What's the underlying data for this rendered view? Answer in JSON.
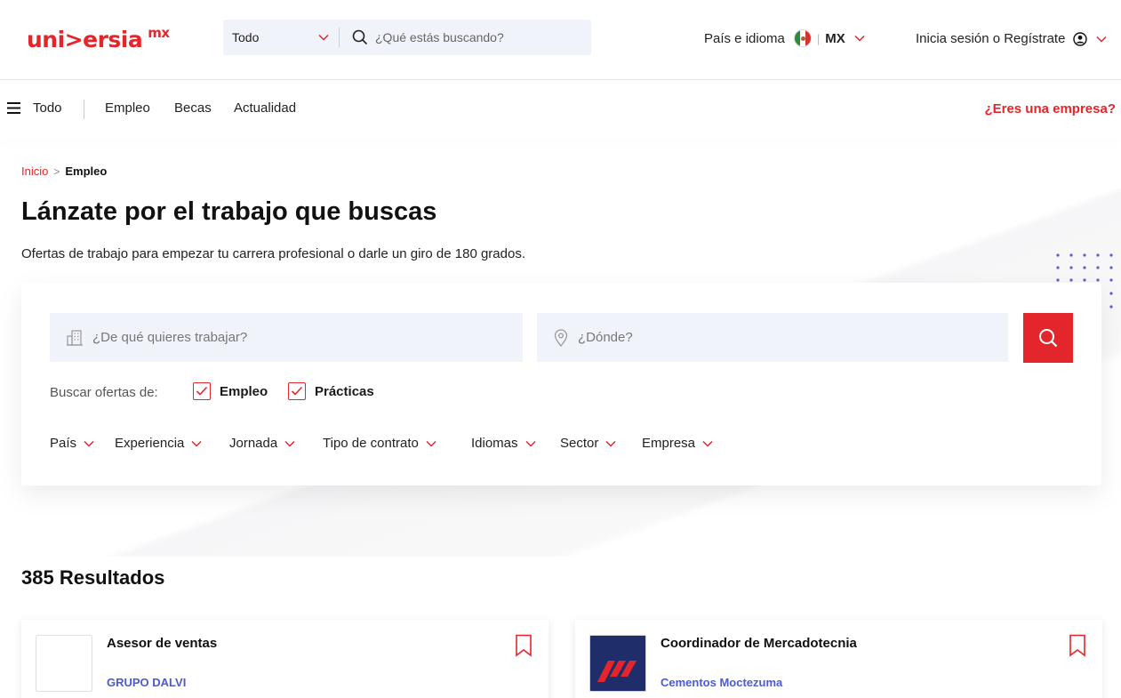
{
  "header": {
    "logo_text": "uni>ersia",
    "logo_suffix": "mx",
    "search_select": "Todo",
    "search_placeholder": "¿Qué estás buscando?",
    "country_label": "País e idioma",
    "country_sep": "|",
    "country_code": "MX",
    "login_label": "Inicia sesión o Regístrate"
  },
  "nav": {
    "menu_label": "Todo",
    "links": [
      "Empleo",
      "Becas",
      "Actualidad"
    ],
    "company_link": "¿Eres una empresa?"
  },
  "breadcrumb": {
    "home": "Inicio",
    "separator": ">",
    "current": "Empleo"
  },
  "hero": {
    "title": "Lánzate por el trabajo que buscas",
    "subtitle": "Ofertas de trabajo para empezar tu carrera profesional o darle un giro de 180 grados."
  },
  "search": {
    "what_placeholder": "¿De qué quieres trabajar?",
    "where_placeholder": "¿Dónde?",
    "filter_label": "Buscar ofertas de:",
    "checks": [
      {
        "label": "Empleo",
        "checked": true
      },
      {
        "label": "Prácticas",
        "checked": true
      }
    ],
    "dropdowns": [
      "País",
      "Experiencia",
      "Jornada",
      "Tipo de contrato",
      "Idiomas",
      "Sector",
      "Empresa"
    ]
  },
  "results": {
    "count_label": "385 Resultados",
    "jobs": [
      {
        "title": "Asesor de ventas",
        "company": "GRUPO DALVI"
      },
      {
        "title": "Coordinador de Mercadotecnia",
        "company": "Cementos Moctezuma"
      }
    ]
  },
  "colors": {
    "brand": "#e3262b",
    "company_link": "#4a5bd4",
    "field_bg": "#f1f3fa",
    "logo_navy": "#1f2d6b"
  }
}
